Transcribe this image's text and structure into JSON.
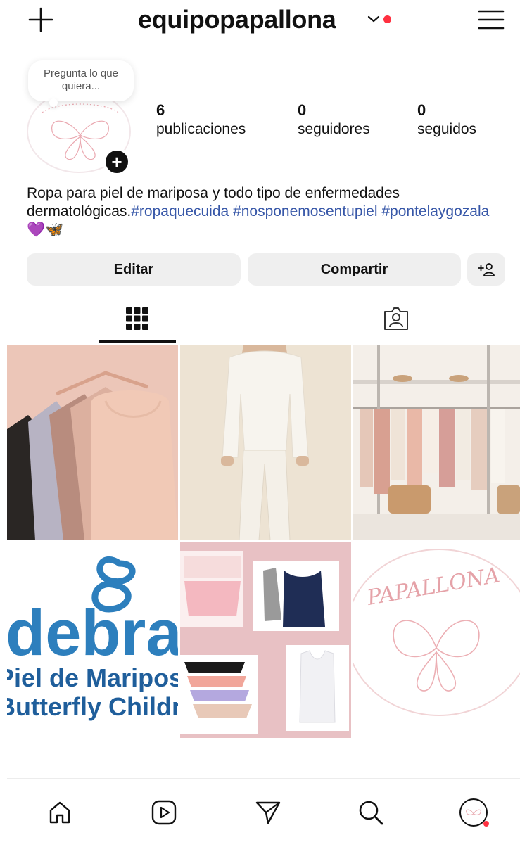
{
  "header": {
    "username": "equipopapallona",
    "create_icon": "plus-icon",
    "switch_icon": "chevron-down-icon",
    "menu_icon": "hamburger-menu-icon",
    "notification_dot_color": "#ff3040"
  },
  "profile": {
    "note_text": "Pregunta lo que quiera...",
    "stats": [
      {
        "count": "6",
        "label": "publicaciones"
      },
      {
        "count": "0",
        "label": "seguidores"
      },
      {
        "count": "0",
        "label": "seguidos"
      }
    ],
    "bio_text": "Ropa para piel de mariposa y todo tipo de enfermedades dermatológicas.",
    "bio_hashtags": "#ropaquecuida #nosponemosentupiel #pontelaygozala",
    "bio_emojis": "💜🦋",
    "hashtag_color": "#3757a8"
  },
  "actions": {
    "edit_label": "Editar",
    "share_label": "Compartir",
    "discover_icon": "add-person-icon"
  },
  "tabs": [
    {
      "icon": "grid-icon",
      "active": true
    },
    {
      "icon": "tagged-icon",
      "active": false
    }
  ],
  "posts": [
    {
      "name": "post-tank-tops"
    },
    {
      "name": "post-white-outfit"
    },
    {
      "name": "post-clothing-rack"
    },
    {
      "name": "post-debra-logo",
      "text_logo": "debra",
      "text_line1": "Piel de Mariposa",
      "text_line2": "Butterfly Children"
    },
    {
      "name": "post-underwear-collage"
    },
    {
      "name": "post-papallona-logo",
      "text_logo": "PAPALLONA"
    }
  ],
  "bottom_nav": [
    {
      "icon": "home-icon"
    },
    {
      "icon": "reels-icon"
    },
    {
      "icon": "direct-message-icon"
    },
    {
      "icon": "search-icon"
    },
    {
      "icon": "profile-avatar-icon"
    }
  ]
}
